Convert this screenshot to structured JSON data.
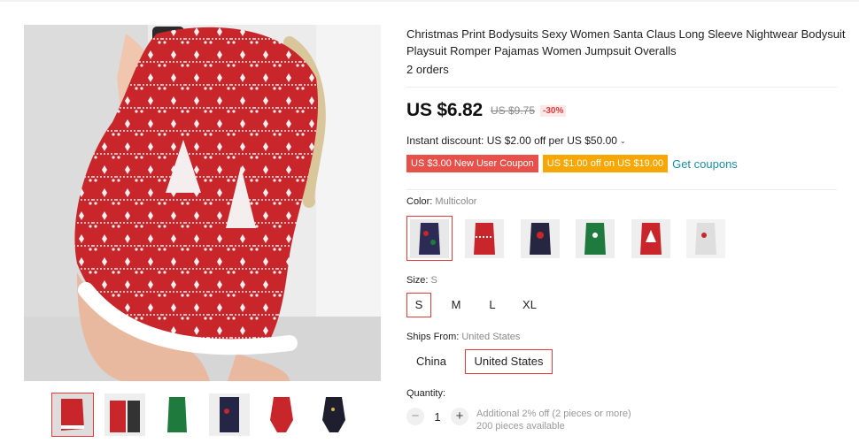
{
  "product": {
    "title": "Christmas Print Bodysuits Sexy Women Santa Claus Long Sleeve Nightwear Bodysuit Playsuit Romper Pajamas Women Jumpsuit Overalls",
    "orders": "2 orders"
  },
  "pricing": {
    "price": "US $6.82",
    "old_price": "US $9.75",
    "discount": "-30%",
    "instant_discount": "Instant discount: US $2.00 off per US $50.00"
  },
  "coupons": {
    "new_user": "US $3.00 New User Coupon",
    "store": "US $1.00 off on US $19.00",
    "get_link": "Get coupons"
  },
  "color": {
    "label": "Color:",
    "selected": "Multicolor",
    "swatches": [
      "navy-print",
      "red-print",
      "navy-santa",
      "green-print",
      "red-tree",
      "white-print"
    ]
  },
  "size": {
    "label": "Size:",
    "selected": "S",
    "options": [
      "S",
      "M",
      "L",
      "XL"
    ]
  },
  "ships_from": {
    "label": "Ships From:",
    "selected": "United States",
    "options": [
      "China",
      "United States"
    ]
  },
  "quantity": {
    "label": "Quantity:",
    "minus": "−",
    "plus": "+",
    "value": "1",
    "additional": "Additional 2% off (2 pieces or more)",
    "available": "200 pieces available"
  },
  "icons": {
    "chevron": "chevron-down-icon"
  },
  "colors": {
    "accent_red": "#e23b3b",
    "coupon_red": "#e8514a",
    "coupon_orange": "#f7a700",
    "link_teal": "#1c8ca3"
  }
}
